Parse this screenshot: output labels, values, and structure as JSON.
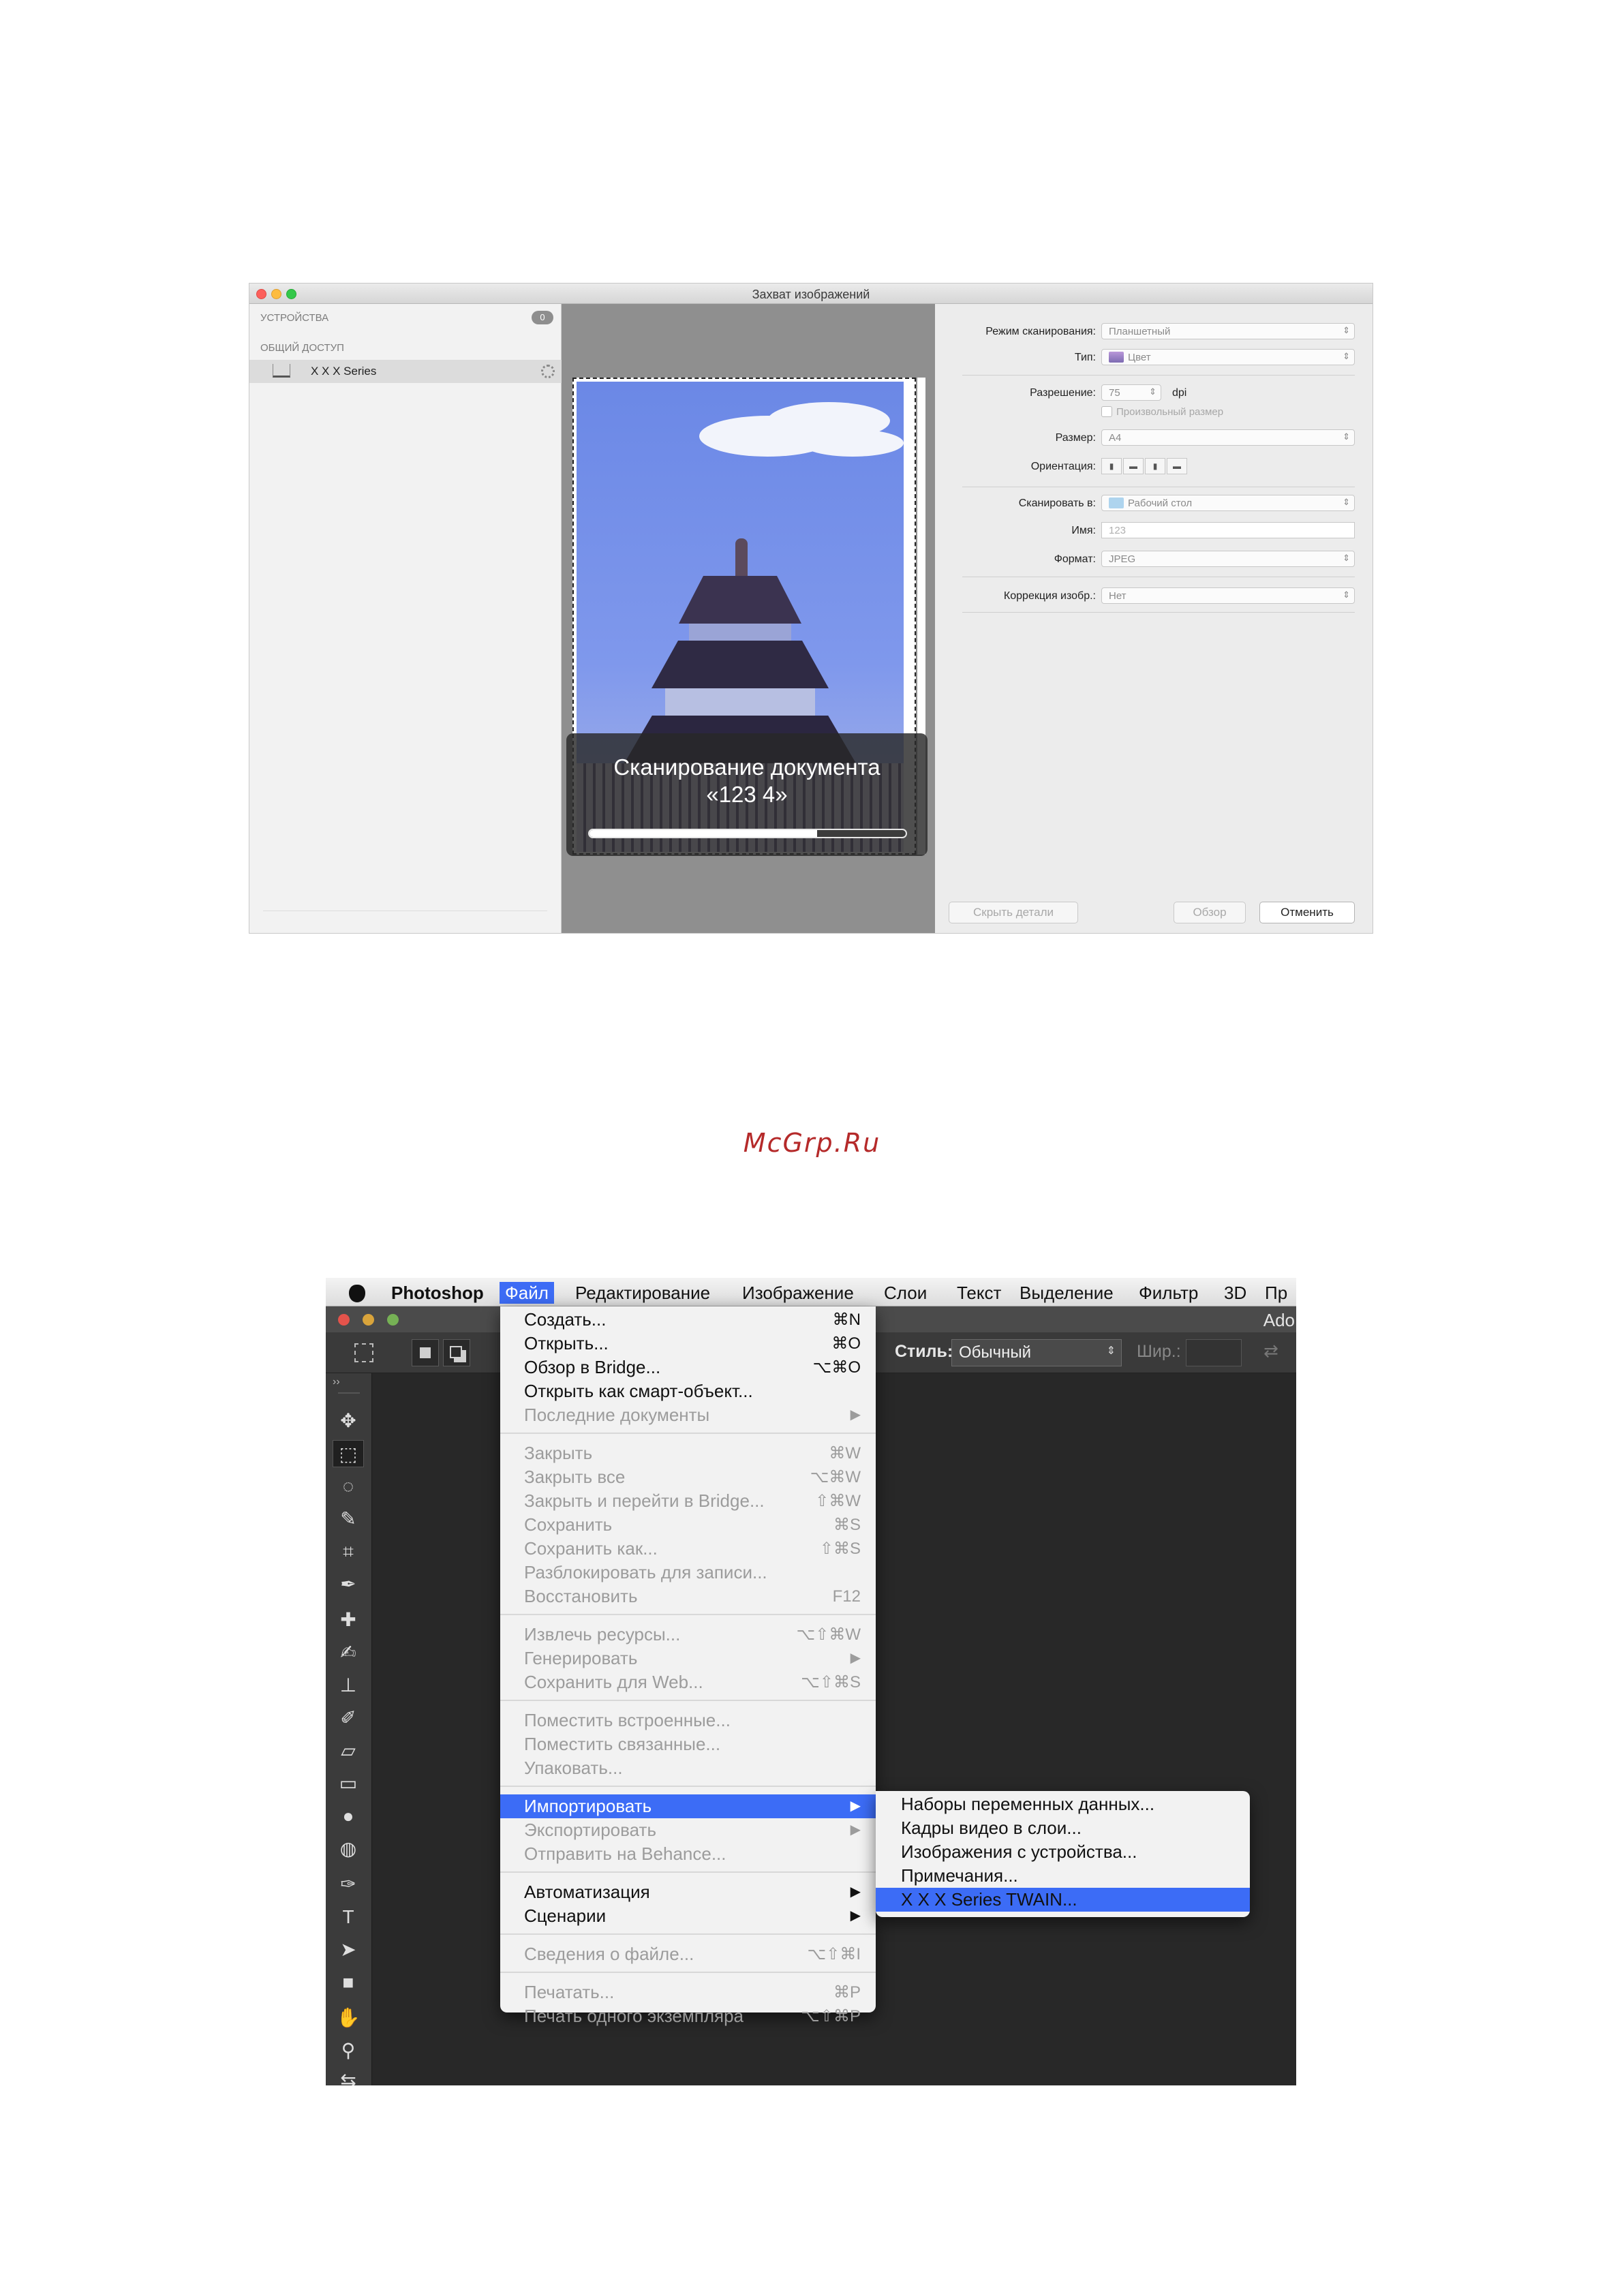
{
  "image_capture": {
    "title": "Захват изображений",
    "sidebar": {
      "devices_heading": "УСТРОЙСТВА",
      "devices_count": "0",
      "shared_heading": "ОБЩИЙ ДОСТУП",
      "device_name": "X X X  Series"
    },
    "progress": {
      "line1": "Сканирование документа",
      "line2": "«123 4»",
      "value_fraction": 0.72
    },
    "settings": {
      "scan_mode": {
        "label": "Режим сканирования:",
        "value": "Планшетный"
      },
      "type": {
        "label": "Тип:",
        "value": "Цвет"
      },
      "resolution": {
        "label": "Разрешение:",
        "value": "75",
        "unit": "dpi"
      },
      "custom_size": {
        "label": "Произвольный размер",
        "checked": false
      },
      "size": {
        "label": "Размер:",
        "value": "A4"
      },
      "orientation": {
        "label": "Ориентация:"
      },
      "scan_to": {
        "label": "Сканировать в:",
        "value": "Рабочий стол"
      },
      "name": {
        "label": "Имя:",
        "value": "123"
      },
      "format": {
        "label": "Формат:",
        "value": "JPEG"
      },
      "correction": {
        "label": "Коррекция изобр.:",
        "value": "Нет"
      }
    },
    "buttons": {
      "hide_details": "Скрыть детали",
      "overview": "Обзор",
      "cancel": "Отменить"
    }
  },
  "watermark": "McGrp.Ru",
  "photoshop": {
    "menubar": {
      "app": "Photoshop",
      "items": [
        "Файл",
        "Редактирование",
        "Изображение",
        "Слои",
        "Текст",
        "Выделение",
        "Фильтр",
        "3D",
        "Пр"
      ]
    },
    "window_title": "Ado",
    "options": {
      "style_label": "Стиль:",
      "style_value": "Обычный",
      "width_label": "Шир.:"
    },
    "file_menu": {
      "items": [
        {
          "label": "Создать...",
          "shortcut": "⌘N",
          "enabled": true
        },
        {
          "label": "Открыть...",
          "shortcut": "⌘O",
          "enabled": true
        },
        {
          "label": "Обзор в Bridge...",
          "shortcut": "⌥⌘O",
          "enabled": true
        },
        {
          "label": "Открыть как смарт-объект...",
          "shortcut": "",
          "enabled": true
        },
        {
          "label": "Последние документы",
          "shortcut": "▶",
          "enabled": false
        },
        {
          "label": "Закрыть",
          "shortcut": "⌘W",
          "enabled": false
        },
        {
          "label": "Закрыть все",
          "shortcut": "⌥⌘W",
          "enabled": false
        },
        {
          "label": "Закрыть и перейти в Bridge...",
          "shortcut": "⇧⌘W",
          "enabled": false
        },
        {
          "label": "Сохранить",
          "shortcut": "⌘S",
          "enabled": false
        },
        {
          "label": "Сохранить как...",
          "shortcut": "⇧⌘S",
          "enabled": false
        },
        {
          "label": "Разблокировать для записи...",
          "shortcut": "",
          "enabled": false
        },
        {
          "label": "Восстановить",
          "shortcut": "F12",
          "enabled": false
        },
        {
          "label": "Извлечь ресурсы...",
          "shortcut": "⌥⇧⌘W",
          "enabled": false
        },
        {
          "label": "Генерировать",
          "shortcut": "▶",
          "enabled": false
        },
        {
          "label": "Сохранить для Web...",
          "shortcut": "⌥⇧⌘S",
          "enabled": false
        },
        {
          "label": "Поместить встроенные...",
          "shortcut": "",
          "enabled": false
        },
        {
          "label": "Поместить связанные...",
          "shortcut": "",
          "enabled": false
        },
        {
          "label": "Упаковать...",
          "shortcut": "",
          "enabled": false
        },
        {
          "label": "Импортировать",
          "shortcut": "▶",
          "enabled": true
        },
        {
          "label": "Экспортировать",
          "shortcut": "▶",
          "enabled": false
        },
        {
          "label": "Отправить на Behance...",
          "shortcut": "",
          "enabled": false
        },
        {
          "label": "Автоматизация",
          "shortcut": "▶",
          "enabled": true
        },
        {
          "label": "Сценарии",
          "shortcut": "▶",
          "enabled": true
        },
        {
          "label": "Сведения о файле...",
          "shortcut": "⌥⇧⌘I",
          "enabled": false
        },
        {
          "label": "Печатать...",
          "shortcut": "⌘P",
          "enabled": false
        },
        {
          "label": "Печать одного экземпляра",
          "shortcut": "⌥⇧⌘P",
          "enabled": false
        }
      ]
    },
    "import_submenu": {
      "items": [
        {
          "label": "Наборы переменных данных...",
          "enabled": false
        },
        {
          "label": "Кадры видео в слои...",
          "enabled": true
        },
        {
          "label": "Изображения с устройства...",
          "enabled": true
        },
        {
          "label": "Примечания...",
          "enabled": false
        },
        {
          "label": "X X X  Series TWAIN...",
          "enabled": true
        }
      ]
    }
  }
}
